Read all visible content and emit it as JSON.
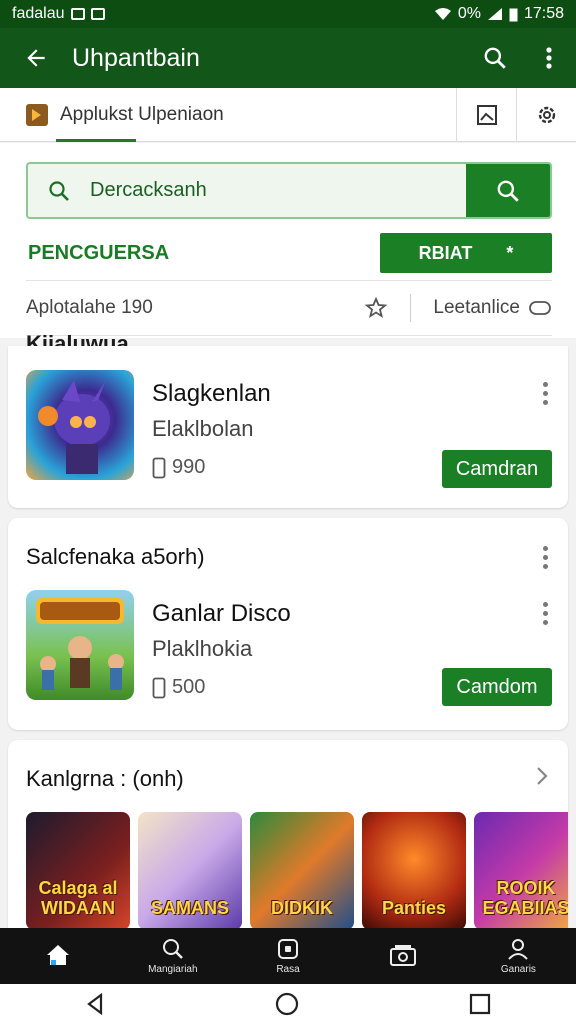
{
  "status_bar": {
    "left_text": "fadalau",
    "battery_text": "0%",
    "time": "17:58"
  },
  "app_bar": {
    "title": "Uhpantbain",
    "back_icon": "arrow-back-icon",
    "search_icon": "search-icon",
    "more_icon": "more-vert-icon"
  },
  "tab": {
    "label": "Applukst Ulpeniaon"
  },
  "search": {
    "placeholder": "Dercacksanh"
  },
  "filter": {
    "label": "PENCGUERSA",
    "button_label": "RBIAT",
    "button_star": "*"
  },
  "info_row": {
    "left": "Aplotalahe 190",
    "right": "Leetanlice"
  },
  "section_partial_title": "Kiialuwua",
  "apps": [
    {
      "name": "Slagkenlan",
      "developer": "Elaklbolan",
      "size": "990",
      "button": "Camdran"
    },
    {
      "section_title": "Salcfenaka a5orh)",
      "name": "Ganlar Disco",
      "developer": "Plaklhokia",
      "size": "500",
      "button": "Camdom"
    }
  ],
  "carousel": {
    "title": "Kanlgrna : (onh)",
    "items": [
      {
        "label": "Calaga al WIDAAN"
      },
      {
        "label": "SAMANS"
      },
      {
        "label": "DIDKIK"
      },
      {
        "label": "Panties"
      },
      {
        "label": "ROOIK EGABIIAS"
      }
    ]
  },
  "bottom_nav": [
    {
      "label": "",
      "icon": "home-icon"
    },
    {
      "label": "Mangiariah",
      "icon": "search-icon"
    },
    {
      "label": "Rasa",
      "icon": "apps-icon"
    },
    {
      "label": "",
      "icon": "library-icon"
    },
    {
      "label": "Ganaris",
      "icon": "person-icon"
    }
  ],
  "colors": {
    "primary": "#13561a",
    "accent": "#1a7f25"
  }
}
